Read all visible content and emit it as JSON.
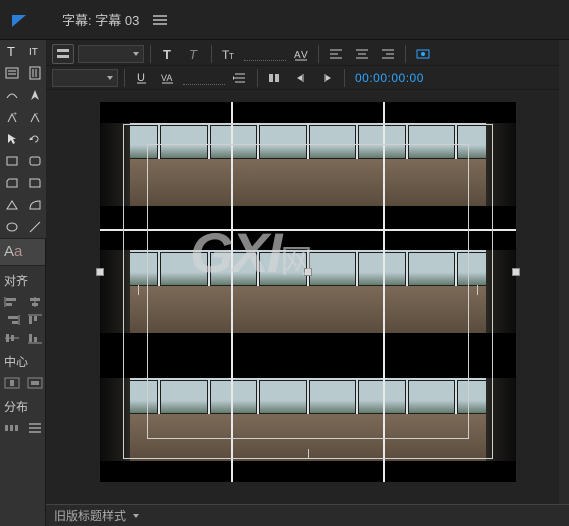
{
  "header": {
    "tab_prefix": "字幕:",
    "tab_name": "字幕 03"
  },
  "options": {
    "timecode": "00:00:00:00"
  },
  "panels": {
    "align": "对齐",
    "center": "中心",
    "distribute": "分布"
  },
  "footer": {
    "styles_label": "旧版标题样式"
  },
  "watermark": {
    "main": "GXI",
    "suffix": "网"
  },
  "icons": {
    "close": "close-triangle",
    "menu": "hamburger"
  }
}
